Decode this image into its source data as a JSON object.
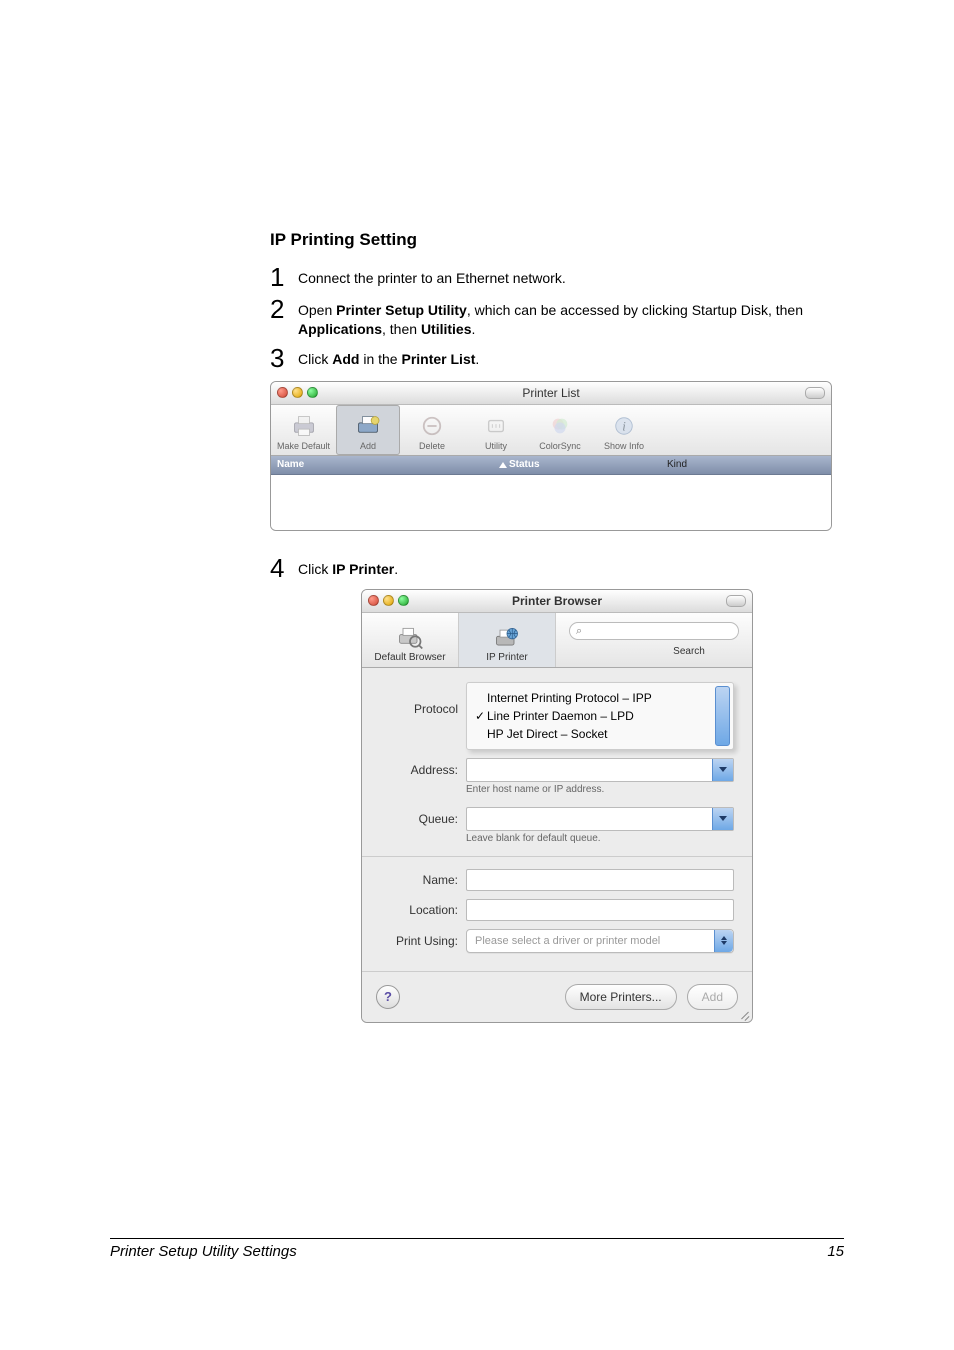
{
  "heading": "IP Printing Setting",
  "steps": {
    "s1": {
      "n": "1",
      "text": "Connect the printer to an Ethernet network."
    },
    "s2": {
      "n": "2",
      "parts": [
        "Open ",
        "Printer Setup Utility",
        ", which can be accessed by clicking Startup Disk, then ",
        "Applications",
        ", then ",
        "Utilities",
        "."
      ]
    },
    "s3": {
      "n": "3",
      "parts": [
        "Click ",
        "Add",
        " in the ",
        "Printer List",
        "."
      ]
    },
    "s4": {
      "n": "4",
      "parts": [
        "Click ",
        "IP Printer",
        "."
      ]
    }
  },
  "printerList": {
    "title": "Printer List",
    "cols": {
      "name": "Name",
      "status": "Status",
      "kind": "Kind"
    },
    "toolbar": {
      "makeDefault": "Make Default",
      "add": "Add",
      "delete": "Delete",
      "utility": "Utility",
      "colorsync": "ColorSync",
      "showInfo": "Show Info"
    }
  },
  "browser": {
    "title": "Printer Browser",
    "tabs": {
      "default": "Default Browser",
      "ip": "IP Printer"
    },
    "searchLabel": "Search",
    "searchPlaceholder": "",
    "protocolLabel": "Protocol",
    "protocolOptions": {
      "ipp": "Internet Printing Protocol – IPP",
      "lpd": "Line Printer Daemon – LPD",
      "hp": "HP Jet Direct – Socket"
    },
    "addressLabel": "Address:",
    "addressHint": "Enter host name or IP address.",
    "queueLabel": "Queue:",
    "queueHint": "Leave blank for default queue.",
    "nameLabel": "Name:",
    "locationLabel": "Location:",
    "printUsingLabel": "Print Using:",
    "printUsingPlaceholder": "Please select a driver or printer model",
    "morePrinters": "More Printers...",
    "add": "Add",
    "help": "?"
  },
  "footer": {
    "title": "Printer Setup Utility Settings",
    "page": "15"
  }
}
